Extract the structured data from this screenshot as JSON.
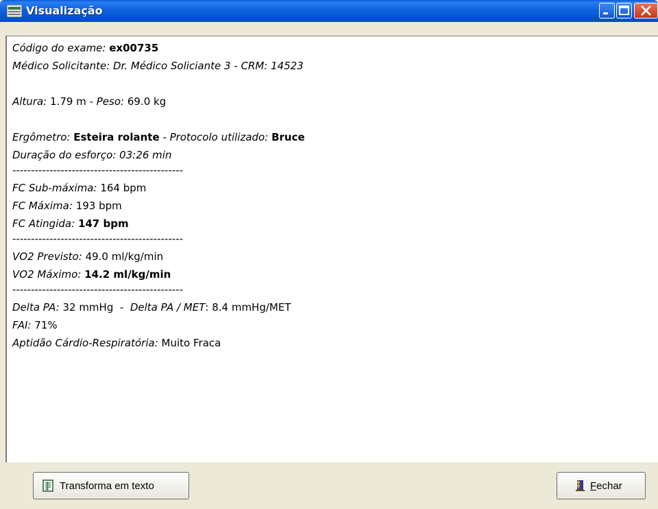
{
  "window": {
    "title": "Visualização"
  },
  "report": {
    "codigo_label": "Código do exame:",
    "codigo_value": "ex00735",
    "medico": "Médico Solicitante: Dr. Médico Soliciante 3 - CRM: 14523",
    "altura_label": "Altura:",
    "altura_value": "1.79 m",
    "dash1": " - ",
    "peso_label": "Peso:",
    "peso_value": "69.0 kg",
    "ergometro_label": "Ergômetro:",
    "ergometro_value": "Esteira rolante",
    "protocolo_label": " - Protocolo utilizado:",
    "protocolo_value": "Bruce",
    "duracao": "Duração do esforço: 03:26 min",
    "separator": "----------------------------------------------",
    "fc_sub_label": "FC Sub-máxima:",
    "fc_sub_value": "164 bpm",
    "fc_max_label": "FC Máxima:",
    "fc_max_value": "193 bpm",
    "fc_ating_label": "FC Atingida:",
    "fc_ating_value": "147 bpm",
    "vo2_prev_label": "VO2 Previsto:",
    "vo2_prev_value": "49.0 ml/kg/min",
    "vo2_max_label": "VO2 Máximo:",
    "vo2_max_value": "14.2 ml/kg/min",
    "delta_pa_label": "Delta PA:",
    "delta_pa_value": "32 mmHg",
    "dash2": "  -  ",
    "delta_pa_met_label": "Delta PA / MET",
    "delta_pa_met_value": ": 8.4 mmHg/MET",
    "fai_label": "FAI:",
    "fai_value": "71%",
    "aptidao_label": "Aptidão Cárdio-Respiratória:",
    "aptidao_value": "Muito Fraca"
  },
  "buttons": {
    "transforma": "Transforma em texto",
    "fechar_accel": "F",
    "fechar_rest": "echar"
  }
}
